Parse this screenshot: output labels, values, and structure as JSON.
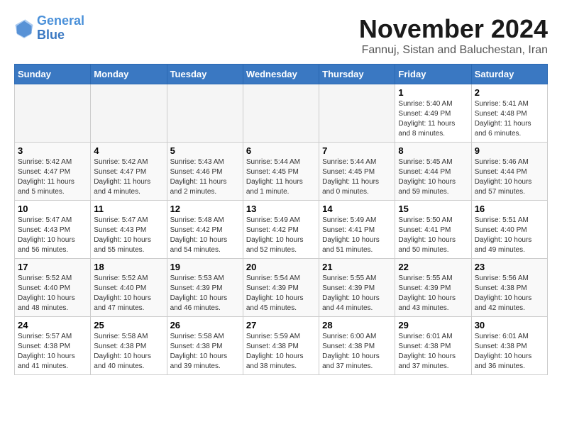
{
  "logo": {
    "line1": "General",
    "line2": "Blue"
  },
  "title": "November 2024",
  "subtitle": "Fannuj, Sistan and Baluchestan, Iran",
  "days_of_week": [
    "Sunday",
    "Monday",
    "Tuesday",
    "Wednesday",
    "Thursday",
    "Friday",
    "Saturday"
  ],
  "weeks": [
    [
      {
        "day": "",
        "info": ""
      },
      {
        "day": "",
        "info": ""
      },
      {
        "day": "",
        "info": ""
      },
      {
        "day": "",
        "info": ""
      },
      {
        "day": "",
        "info": ""
      },
      {
        "day": "1",
        "info": "Sunrise: 5:40 AM\nSunset: 4:49 PM\nDaylight: 11 hours and 8 minutes."
      },
      {
        "day": "2",
        "info": "Sunrise: 5:41 AM\nSunset: 4:48 PM\nDaylight: 11 hours and 6 minutes."
      }
    ],
    [
      {
        "day": "3",
        "info": "Sunrise: 5:42 AM\nSunset: 4:47 PM\nDaylight: 11 hours and 5 minutes."
      },
      {
        "day": "4",
        "info": "Sunrise: 5:42 AM\nSunset: 4:47 PM\nDaylight: 11 hours and 4 minutes."
      },
      {
        "day": "5",
        "info": "Sunrise: 5:43 AM\nSunset: 4:46 PM\nDaylight: 11 hours and 2 minutes."
      },
      {
        "day": "6",
        "info": "Sunrise: 5:44 AM\nSunset: 4:45 PM\nDaylight: 11 hours and 1 minute."
      },
      {
        "day": "7",
        "info": "Sunrise: 5:44 AM\nSunset: 4:45 PM\nDaylight: 11 hours and 0 minutes."
      },
      {
        "day": "8",
        "info": "Sunrise: 5:45 AM\nSunset: 4:44 PM\nDaylight: 10 hours and 59 minutes."
      },
      {
        "day": "9",
        "info": "Sunrise: 5:46 AM\nSunset: 4:44 PM\nDaylight: 10 hours and 57 minutes."
      }
    ],
    [
      {
        "day": "10",
        "info": "Sunrise: 5:47 AM\nSunset: 4:43 PM\nDaylight: 10 hours and 56 minutes."
      },
      {
        "day": "11",
        "info": "Sunrise: 5:47 AM\nSunset: 4:43 PM\nDaylight: 10 hours and 55 minutes."
      },
      {
        "day": "12",
        "info": "Sunrise: 5:48 AM\nSunset: 4:42 PM\nDaylight: 10 hours and 54 minutes."
      },
      {
        "day": "13",
        "info": "Sunrise: 5:49 AM\nSunset: 4:42 PM\nDaylight: 10 hours and 52 minutes."
      },
      {
        "day": "14",
        "info": "Sunrise: 5:49 AM\nSunset: 4:41 PM\nDaylight: 10 hours and 51 minutes."
      },
      {
        "day": "15",
        "info": "Sunrise: 5:50 AM\nSunset: 4:41 PM\nDaylight: 10 hours and 50 minutes."
      },
      {
        "day": "16",
        "info": "Sunrise: 5:51 AM\nSunset: 4:40 PM\nDaylight: 10 hours and 49 minutes."
      }
    ],
    [
      {
        "day": "17",
        "info": "Sunrise: 5:52 AM\nSunset: 4:40 PM\nDaylight: 10 hours and 48 minutes."
      },
      {
        "day": "18",
        "info": "Sunrise: 5:52 AM\nSunset: 4:40 PM\nDaylight: 10 hours and 47 minutes."
      },
      {
        "day": "19",
        "info": "Sunrise: 5:53 AM\nSunset: 4:39 PM\nDaylight: 10 hours and 46 minutes."
      },
      {
        "day": "20",
        "info": "Sunrise: 5:54 AM\nSunset: 4:39 PM\nDaylight: 10 hours and 45 minutes."
      },
      {
        "day": "21",
        "info": "Sunrise: 5:55 AM\nSunset: 4:39 PM\nDaylight: 10 hours and 44 minutes."
      },
      {
        "day": "22",
        "info": "Sunrise: 5:55 AM\nSunset: 4:39 PM\nDaylight: 10 hours and 43 minutes."
      },
      {
        "day": "23",
        "info": "Sunrise: 5:56 AM\nSunset: 4:38 PM\nDaylight: 10 hours and 42 minutes."
      }
    ],
    [
      {
        "day": "24",
        "info": "Sunrise: 5:57 AM\nSunset: 4:38 PM\nDaylight: 10 hours and 41 minutes."
      },
      {
        "day": "25",
        "info": "Sunrise: 5:58 AM\nSunset: 4:38 PM\nDaylight: 10 hours and 40 minutes."
      },
      {
        "day": "26",
        "info": "Sunrise: 5:58 AM\nSunset: 4:38 PM\nDaylight: 10 hours and 39 minutes."
      },
      {
        "day": "27",
        "info": "Sunrise: 5:59 AM\nSunset: 4:38 PM\nDaylight: 10 hours and 38 minutes."
      },
      {
        "day": "28",
        "info": "Sunrise: 6:00 AM\nSunset: 4:38 PM\nDaylight: 10 hours and 37 minutes."
      },
      {
        "day": "29",
        "info": "Sunrise: 6:01 AM\nSunset: 4:38 PM\nDaylight: 10 hours and 37 minutes."
      },
      {
        "day": "30",
        "info": "Sunrise: 6:01 AM\nSunset: 4:38 PM\nDaylight: 10 hours and 36 minutes."
      }
    ]
  ]
}
